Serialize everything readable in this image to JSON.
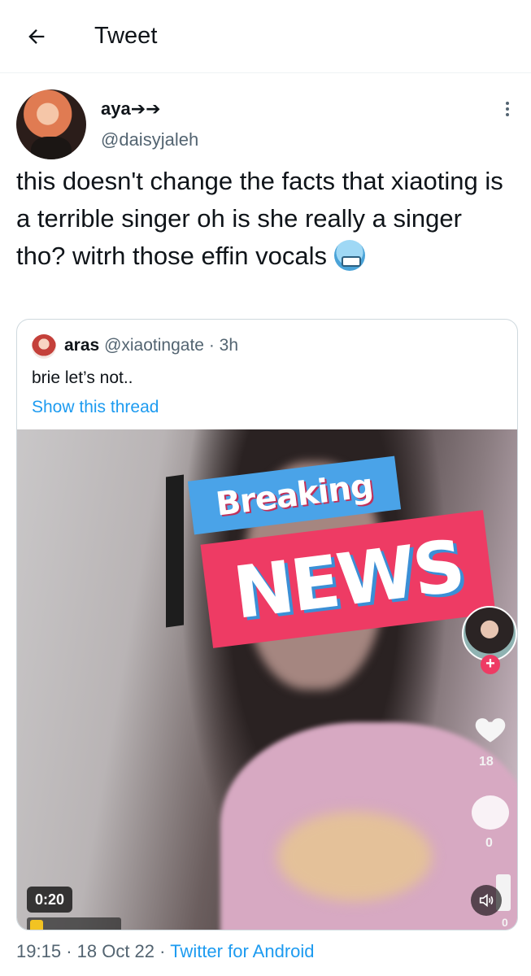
{
  "header": {
    "title": "Tweet"
  },
  "tweet": {
    "display_name": "aya➔➔",
    "handle": "@daisyjaleh",
    "text": "this doesn't change the facts that xiaoting is a terrible singer oh is she really a singer tho? witrh those effin vocals"
  },
  "quoted": {
    "name": "aras",
    "handle": "@xiaotingate",
    "separator": "·",
    "time": "3h",
    "text": "brie let’s not..",
    "thread_link": "Show this thread",
    "media": {
      "overlay_breaking": "Breaking",
      "overlay_news": "NEWS",
      "like_count": "18",
      "comment_count": "0",
      "share_count": "0",
      "duration": "0:20",
      "accent_pink": "#ee3b64",
      "accent_blue": "#4aa3e8"
    }
  },
  "footer": {
    "time": "19:15",
    "sep1": "·",
    "date": "18 Oct 22",
    "sep2": "·",
    "source": "Twitter for Android"
  },
  "colors": {
    "link": "#1d9bf0",
    "secondary_text": "#536471",
    "primary_text": "#0f1419",
    "border": "#cfd9de"
  }
}
